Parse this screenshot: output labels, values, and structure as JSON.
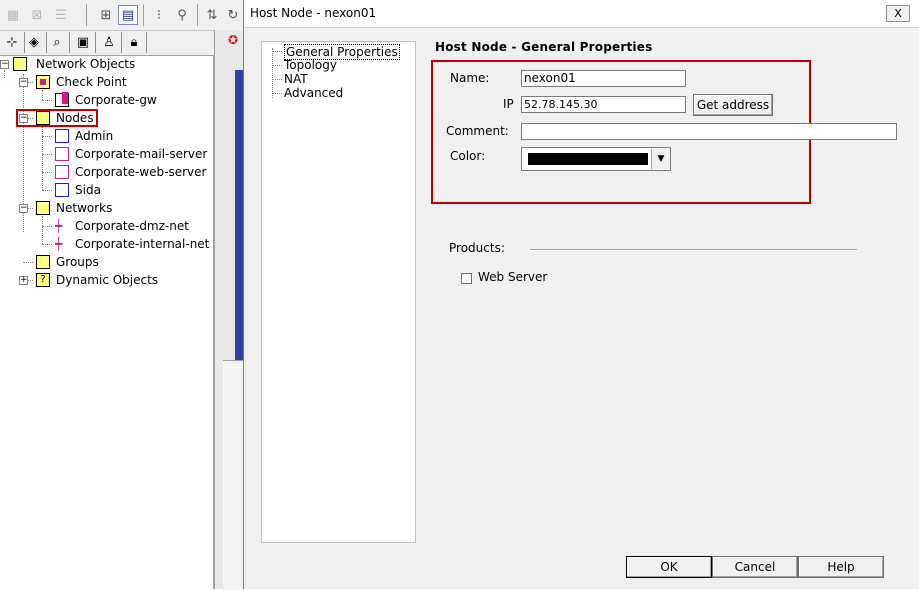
{
  "tree": {
    "root": "Network Objects",
    "items": [
      {
        "label": "Check Point"
      },
      {
        "label": "Corporate-gw"
      },
      {
        "label": "Nodes"
      },
      {
        "label": "Admin"
      },
      {
        "label": "Corporate-mail-server"
      },
      {
        "label": "Corporate-web-server"
      },
      {
        "label": "Sida"
      },
      {
        "label": "Networks"
      },
      {
        "label": "Corporate-dmz-net"
      },
      {
        "label": "Corporate-internal-net"
      },
      {
        "label": "Groups"
      },
      {
        "label": "Dynamic Objects"
      }
    ]
  },
  "dialog": {
    "title": "Host Node - nexon01",
    "close_label": "X",
    "nav": [
      "General Properties",
      "Topology",
      "NAT",
      "Advanced"
    ],
    "heading": "Host Node - General Properties",
    "name_label": "Name:",
    "name_value": "nexon01",
    "ip_label": "IP",
    "ip_value": "52.78.145.30",
    "get_address_label": "Get address",
    "comment_label": "Comment:",
    "comment_value": "",
    "color_label": "Color:",
    "color_value": "#000000",
    "products_label": "Products:",
    "web_server_label": "Web Server",
    "ok_label": "OK",
    "cancel_label": "Cancel",
    "help_label": "Help"
  },
  "colors": {
    "highlight_border": "#c00000",
    "dialog_bg": "#f0f0f0"
  }
}
